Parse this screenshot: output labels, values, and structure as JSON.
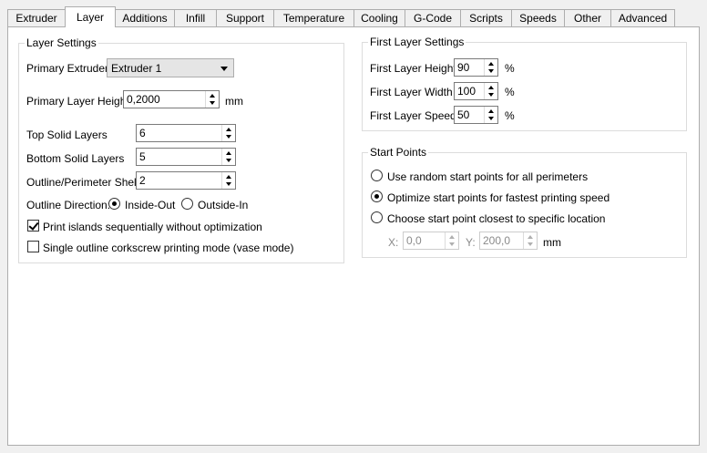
{
  "tabs": [
    {
      "label": "Extruder"
    },
    {
      "label": "Layer"
    },
    {
      "label": "Additions"
    },
    {
      "label": "Infill"
    },
    {
      "label": "Support"
    },
    {
      "label": "Temperature"
    },
    {
      "label": "Cooling"
    },
    {
      "label": "G-Code"
    },
    {
      "label": "Scripts"
    },
    {
      "label": "Speeds"
    },
    {
      "label": "Other"
    },
    {
      "label": "Advanced"
    }
  ],
  "active_tab": "Layer",
  "layer_settings": {
    "title": "Layer Settings",
    "primary_extruder_label": "Primary Extruder",
    "primary_extruder_value": "Extruder 1",
    "primary_layer_height_label": "Primary Layer Height",
    "primary_layer_height_value": "0,2000",
    "primary_layer_height_unit": "mm",
    "top_solid_layers_label": "Top Solid Layers",
    "top_solid_layers_value": "6",
    "bottom_solid_layers_label": "Bottom Solid Layers",
    "bottom_solid_layers_value": "5",
    "outline_shells_label": "Outline/Perimeter Shells",
    "outline_shells_value": "2",
    "outline_direction_label": "Outline Direction:",
    "inside_out_label": "Inside-Out",
    "inside_out_selected": true,
    "outside_in_label": "Outside-In",
    "outside_in_selected": false,
    "print_islands_label": "Print islands sequentially without optimization",
    "print_islands_checked": true,
    "vase_mode_label": "Single outline corkscrew printing mode (vase mode)",
    "vase_mode_checked": false
  },
  "first_layer_settings": {
    "title": "First Layer Settings",
    "height_label": "First Layer Height",
    "height_value": "90",
    "width_label": "First Layer Width",
    "width_value": "100",
    "speed_label": "First Layer Speed",
    "speed_value": "50",
    "unit": "%"
  },
  "start_points": {
    "title": "Start Points",
    "random_label": "Use random start points for all perimeters",
    "optimize_label": "Optimize start points for fastest printing speed",
    "closest_label": "Choose start point closest to specific location",
    "selected": "optimize",
    "x_label": "X:",
    "x_value": "0,0",
    "y_label": "Y:",
    "y_value": "200,0",
    "unit": "mm"
  }
}
